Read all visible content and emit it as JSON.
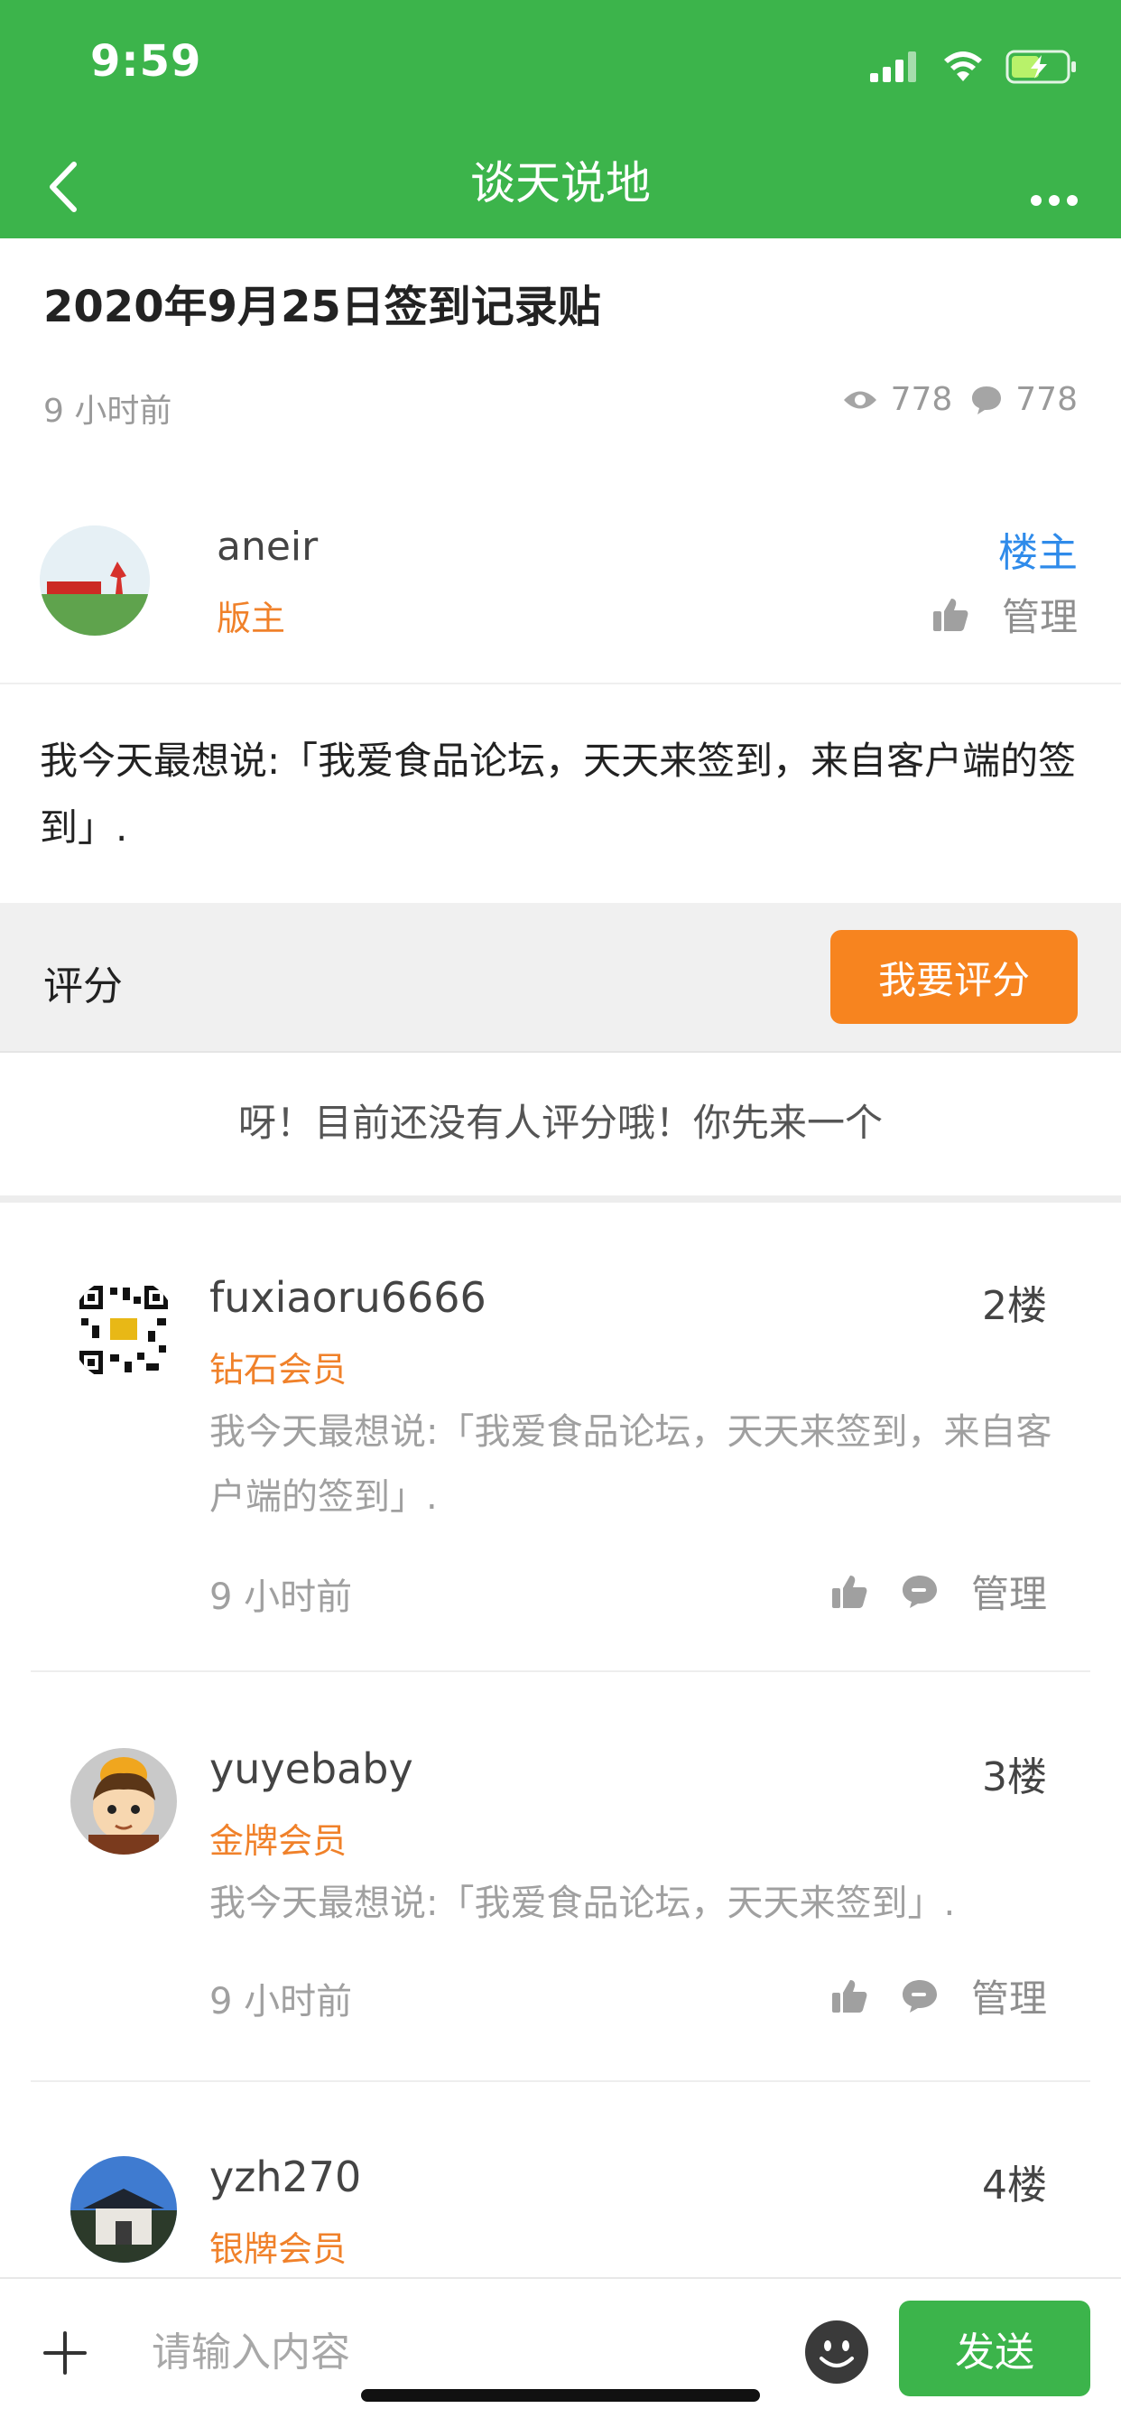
{
  "status_bar": {
    "time": "9:59"
  },
  "nav": {
    "title": "谈天说地"
  },
  "post": {
    "title": "2020年9月25日签到记录贴",
    "time_ago": "9 小时前",
    "views": "778",
    "comments": "778",
    "author": {
      "name": "aneir",
      "role": "版主",
      "owner_tag": "楼主",
      "manage_label": "管理"
    },
    "body": "我今天最想说:「我爱食品论坛，天天来签到，来自客户端的签到」."
  },
  "rating": {
    "label": "评分",
    "button_label": "我要评分",
    "empty_text": "呀！目前还没有人评分哦！你先来一个"
  },
  "replies": [
    {
      "name": "fuxiaoru6666",
      "floor": "2楼",
      "level": "钻石会员",
      "content": "我今天最想说:「我爱食品论坛，天天来签到，来自客户端的签到」.",
      "time_ago": "9 小时前",
      "manage_label": "管理"
    },
    {
      "name": "yuyebaby",
      "floor": "3楼",
      "level": "金牌会员",
      "content": "我今天最想说:「我爱食品论坛，天天来签到」.",
      "time_ago": "9 小时前",
      "manage_label": "管理"
    },
    {
      "name": "yzh270",
      "floor": "4楼",
      "level": "银牌会员"
    }
  ],
  "input_bar": {
    "placeholder": "请输入内容",
    "send_label": "发送"
  },
  "colors": {
    "brand_green": "#3cb44b",
    "accent_orange": "#f7841f",
    "link_blue": "#2f8bea",
    "level_orange": "#f0812a"
  }
}
